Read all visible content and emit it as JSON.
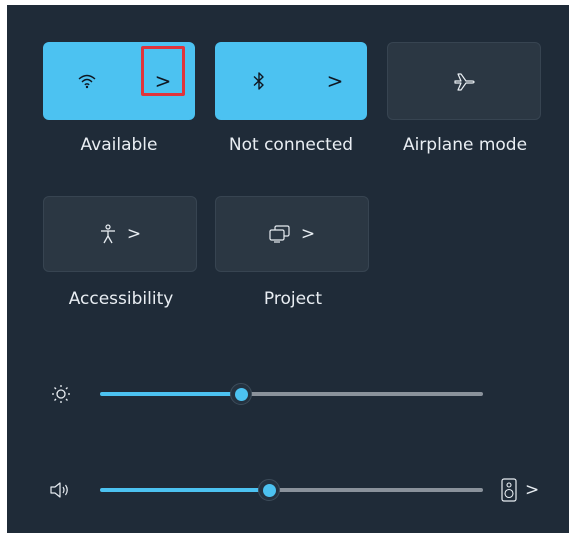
{
  "quick_settings": {
    "tiles": [
      {
        "id": "wifi",
        "label": "Available",
        "active": true,
        "icon": "wifi-icon",
        "has_chevron": true
      },
      {
        "id": "bluetooth",
        "label": "Not connected",
        "active": true,
        "icon": "bluetooth-icon",
        "has_chevron": true
      },
      {
        "id": "airplane",
        "label": "Airplane mode",
        "active": false,
        "icon": "airplane-icon",
        "has_chevron": false
      },
      {
        "id": "accessibility",
        "label": "Accessibility",
        "active": false,
        "icon": "accessibility-icon",
        "has_chevron": true
      },
      {
        "id": "project",
        "label": "Project",
        "active": false,
        "icon": "project-icon",
        "has_chevron": true
      }
    ],
    "chevron_glyph": ">",
    "brightness": {
      "icon": "brightness-icon",
      "value_fraction": 0.37
    },
    "volume": {
      "icon": "speaker-icon",
      "value_fraction": 0.44,
      "output_icon": "audio-device-icon"
    }
  },
  "colors": {
    "accent": "#4cc2f1",
    "panel_bg": "#1f2b38",
    "tile_inactive": "#2b3743",
    "highlight": "#e0343b"
  }
}
